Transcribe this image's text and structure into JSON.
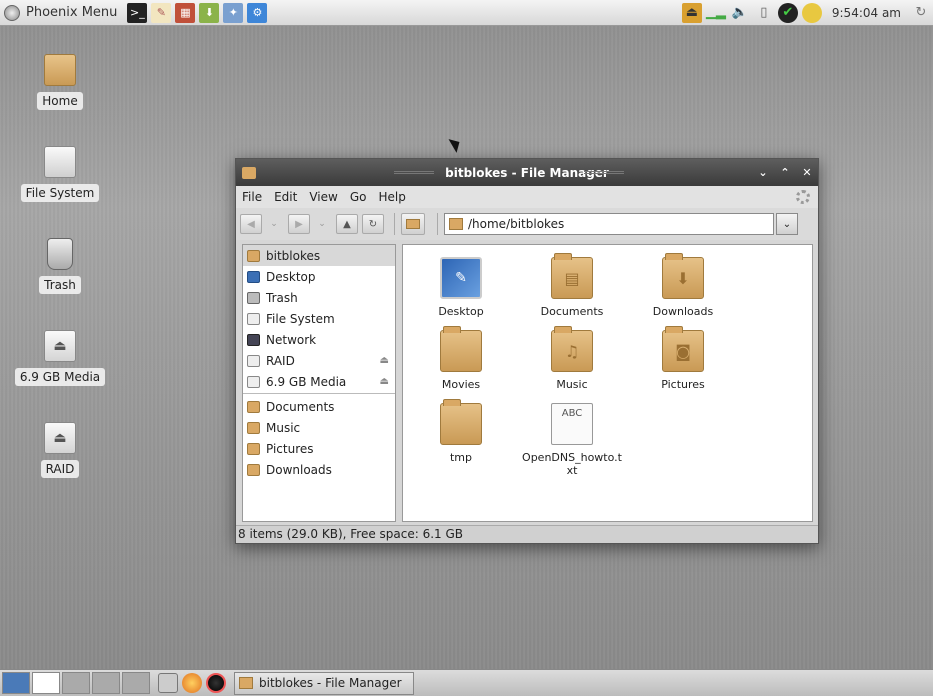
{
  "top_panel": {
    "menu_label": "Phoenix Menu",
    "clock": "9:54:04 am",
    "launchers": [
      "terminal-icon",
      "text-editor-icon",
      "archive-icon",
      "package-installer-icon",
      "settings-tools-icon",
      "network-config-icon"
    ],
    "tray": [
      "user-switch-icon",
      "network-monitor-icon",
      "volume-icon",
      "clipboard-icon",
      "update-check-icon",
      "notification-icon"
    ]
  },
  "desktop": {
    "icons": [
      {
        "label": "Home",
        "icon": "home-folder-icon"
      },
      {
        "label": "File System",
        "icon": "drive-icon"
      },
      {
        "label": "Trash",
        "icon": "trash-icon"
      },
      {
        "label": "6.9 GB Media",
        "icon": "removable-drive-icon"
      },
      {
        "label": "RAID",
        "icon": "removable-drive-icon"
      }
    ]
  },
  "window": {
    "title": "bitblokes - File Manager",
    "menu": [
      "File",
      "Edit",
      "View",
      "Go",
      "Help"
    ],
    "path": "/home/bitblokes",
    "sidebar": {
      "places": [
        {
          "label": "bitblokes",
          "icon": "home-folder-icon",
          "selected": true
        },
        {
          "label": "Desktop",
          "icon": "desktop-icon"
        },
        {
          "label": "Trash",
          "icon": "trash-icon"
        },
        {
          "label": "File System",
          "icon": "drive-icon"
        },
        {
          "label": "Network",
          "icon": "network-icon"
        },
        {
          "label": "RAID",
          "icon": "drive-icon",
          "eject": true
        },
        {
          "label": "6.9 GB Media",
          "icon": "drive-icon",
          "eject": true
        }
      ],
      "bookmarks": [
        {
          "label": "Documents",
          "icon": "folder-icon"
        },
        {
          "label": "Music",
          "icon": "folder-icon"
        },
        {
          "label": "Pictures",
          "icon": "folder-icon"
        },
        {
          "label": "Downloads",
          "icon": "folder-icon"
        }
      ]
    },
    "files": [
      {
        "label": "Desktop",
        "icon": "desktop-folder-icon"
      },
      {
        "label": "Documents",
        "icon": "documents-folder-icon"
      },
      {
        "label": "Downloads",
        "icon": "downloads-folder-icon"
      },
      {
        "label": "Movies",
        "icon": "folder-icon"
      },
      {
        "label": "Music",
        "icon": "music-folder-icon"
      },
      {
        "label": "Pictures",
        "icon": "pictures-folder-icon"
      },
      {
        "label": "tmp",
        "icon": "folder-icon"
      },
      {
        "label": "OpenDNS_howto.txt",
        "icon": "text-file-icon",
        "thumb_text": "ABC"
      }
    ],
    "status": "8 items (29.0 KB), Free space: 6.1 GB"
  },
  "taskbar": {
    "task_label": "bitblokes - File Manager"
  },
  "colors": {
    "folder": "#d9a864",
    "titlebar": "#4a4a4a",
    "selection": "#d8d8d8"
  }
}
